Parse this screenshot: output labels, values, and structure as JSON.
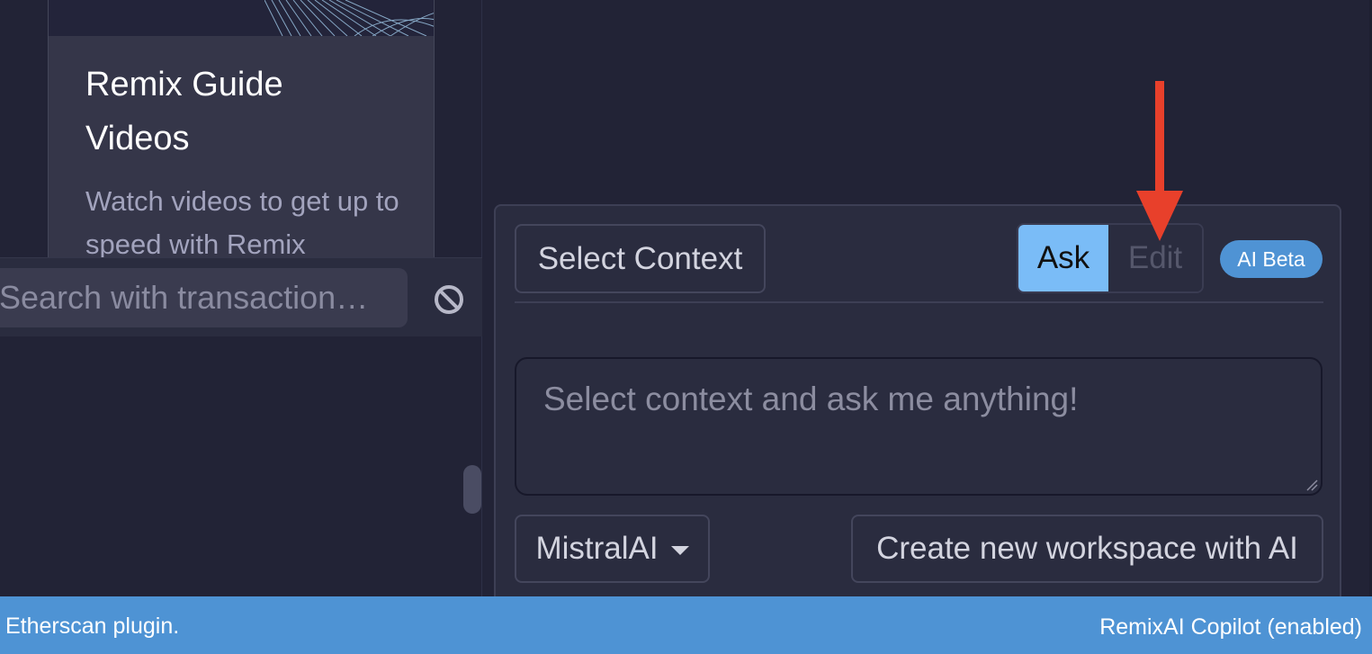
{
  "guide_card": {
    "title": "Remix Guide Videos",
    "description": "Watch videos to get up to speed with Remix"
  },
  "terminal": {
    "search_placeholder": "Search with transaction hash or address",
    "clear_icon": "ban-icon"
  },
  "ai_panel": {
    "select_context_label": "Select Context",
    "mode_ask_label": "Ask",
    "mode_edit_label": "Edit",
    "active_mode": "Ask",
    "badge_label": "AI Beta",
    "prompt_placeholder": "Select context and ask me anything!",
    "model_label": "MistralAI",
    "create_workspace_label": "Create new workspace with AI"
  },
  "status_bar": {
    "left_text": "Etherscan plugin.",
    "right_text": "RemixAI Copilot (enabled)"
  },
  "colors": {
    "background": "#222336",
    "panel": "#2a2c3f",
    "accent_active": "#7abcf7",
    "status_bar": "#4e93d4",
    "annotation_arrow": "#e8402b"
  }
}
